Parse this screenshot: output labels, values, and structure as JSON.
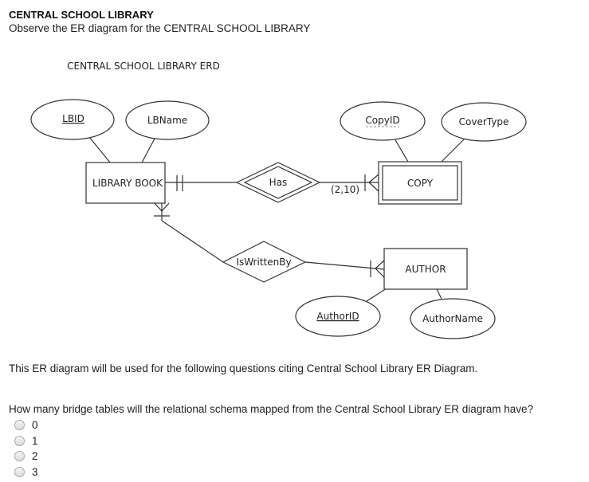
{
  "header": {
    "title": "CENTRAL SCHOOL LIBRARY",
    "subtitle": "Observe the ER diagram for the CENTRAL SCHOOL LIBRARY"
  },
  "diagram": {
    "title": "CENTRAL SCHOOL LIBRARY ERD",
    "entities": [
      {
        "name": "LIBRARY BOOK",
        "type": "strong"
      },
      {
        "name": "COPY",
        "type": "weak"
      },
      {
        "name": "AUTHOR",
        "type": "strong"
      }
    ],
    "attributes": [
      {
        "name": "LBID",
        "entity": "LIBRARY BOOK",
        "key": "primary"
      },
      {
        "name": "LBName",
        "entity": "LIBRARY BOOK",
        "key": "none"
      },
      {
        "name": "CopyID",
        "entity": "COPY",
        "key": "partial"
      },
      {
        "name": "CoverType",
        "entity": "COPY",
        "key": "none"
      },
      {
        "name": "AuthorID",
        "entity": "AUTHOR",
        "key": "primary"
      },
      {
        "name": "AuthorName",
        "entity": "AUTHOR",
        "key": "none"
      }
    ],
    "relationships": [
      {
        "name": "Has",
        "type": "identifying",
        "from": "LIBRARY BOOK",
        "to": "COPY",
        "cardinality_label": "(2,10)"
      },
      {
        "name": "IsWrittenBy",
        "type": "regular",
        "from": "LIBRARY BOOK",
        "to": "AUTHOR"
      }
    ]
  },
  "note": "This ER diagram will be used for the following questions citing Central School Library ER Diagram.",
  "question": {
    "text": "How many bridge tables will the relational schema mapped from the Central School Library ER diagram have?",
    "options": [
      "0",
      "1",
      "2",
      "3"
    ],
    "selected": null
  }
}
